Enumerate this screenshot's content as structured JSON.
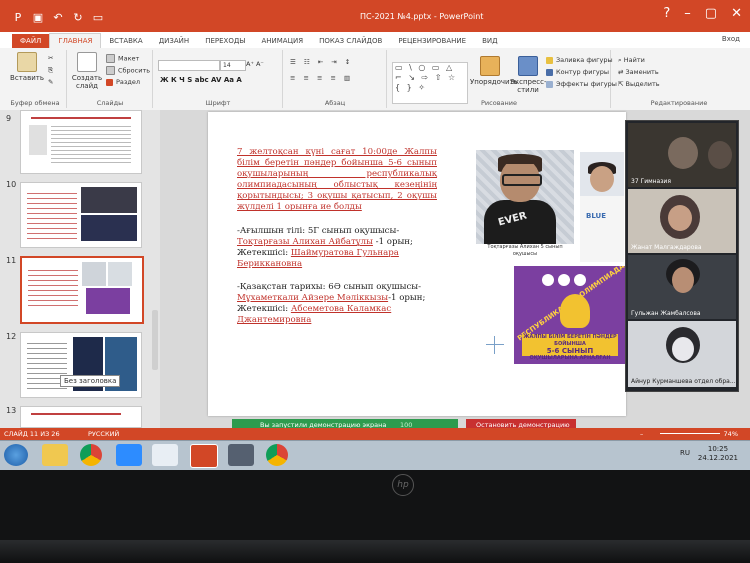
{
  "window": {
    "title": "ПС-2021 №4.pptx - PowerPoint",
    "user": "Вход"
  },
  "tabs": [
    "ФАЙЛ",
    "ГЛАВНАЯ",
    "ВСТАВКА",
    "ДИЗАЙН",
    "ПЕРЕХОДЫ",
    "АНИМАЦИЯ",
    "ПОКАЗ СЛАЙДОВ",
    "РЕЦЕНЗИРОВАНИЕ",
    "ВИД"
  ],
  "ribbon": {
    "clipboard": {
      "paste": "Вставить",
      "label": "Буфер обмена"
    },
    "slides": {
      "new_slide": "Создать слайд",
      "layout": "Макет",
      "reset": "Сбросить",
      "section": "Раздел",
      "label": "Слайды"
    },
    "font": {
      "font_size": "14",
      "label": "Шрифт",
      "format_row": "Ж К Ч S abc AV Аа A"
    },
    "paragraph": {
      "label": "Абзац"
    },
    "drawing": {
      "arrange": "Упорядочить",
      "styles": "Экспресс-стили",
      "fill": "Заливка фигуры",
      "outline": "Контур фигуры",
      "effects": "Эффекты фигуры",
      "label": "Рисование",
      "shapes": "▭ \\ ○ ▭ △ ⌐ ↘ ⇨ ⇧ ☆ { } ✧"
    },
    "editing": {
      "find": "Найти",
      "replace": "Заменить",
      "select": "Выделить",
      "label": "Редактирование"
    }
  },
  "thumbnails": {
    "numbers": [
      "9",
      "10",
      "11",
      "12",
      "13"
    ],
    "tooltip": "Без заголовка"
  },
  "slide": {
    "para1": "7 желтоқсан күні сағат 10:00де Жалпы білім беретін пәндер бойынша 5-6 сынып оқушыларының республикалық олимпиадасының облыстық кезеңінің қорытындысы; 3 оқушы қатысып, 2 оқушы жүлделі 1 орынға ие болды",
    "para2_head": "-Ағылшын тілі: 5Г сынып оқушысы-",
    "para2_name": "Тоқтарғазы Алихан Айбатұлы",
    "para2_place": " -1 орын;",
    "para2_teacher_label": "Жетекшісі: ",
    "para2_teacher": "Шаймуратова Гульнара Бериккановна",
    "para3_head": "-Қазақстан тарихы: 6Ә сынып оқушысы-",
    "para3_name": "Мұхаметкали Айзере Мәліккызы",
    "para3_place": "-1 орын;",
    "para3_teacher_label": "Жетекшісі: ",
    "para3_teacher": "Абсеметова Каламкас Джантемировна",
    "photo1_caption": "Тоқтарғазы Алихан 5 сынып оқушысы",
    "photo1_shirt": "EVER",
    "photo2_shirt": "BLUE",
    "olymp_arc": "РЕСПУБЛИКАЛЫҚ ОЛИМПИАДА",
    "olymp_band_top": "ЖАЛПЫ БІЛІМ БЕРЕТІН ПӘНДЕР БОЙЫНША",
    "olymp_band_mid": "5-6 СЫНЫП",
    "olymp_band_bot": "ОҚУШЫЛАРЫНА АРНАЛҒАН"
  },
  "video_call": {
    "participants": [
      {
        "name": "37 Гимназия"
      },
      {
        "name": "Жанат Малгаждарова"
      },
      {
        "name": "Гульжан Жамбалсова"
      },
      {
        "name": "Айнур Курманшева отдел обра..."
      }
    ]
  },
  "statusbar": {
    "slide_info": "СЛАЙД 11 ИЗ 26",
    "language": "РУССКИЙ",
    "zoom": "74%",
    "share_text": "Вы запустили демонстрацию экрана",
    "share_pct": "100",
    "stop_share": "Остановить демонстрацию"
  },
  "taskbar": {
    "lang": "RU",
    "time": "10:25",
    "date": "24.12.2021"
  },
  "brand": {
    "accent": "#d24726",
    "share_green": "#2e9b4e",
    "stop_red": "#c83030",
    "slide_red": "#c0322b"
  }
}
